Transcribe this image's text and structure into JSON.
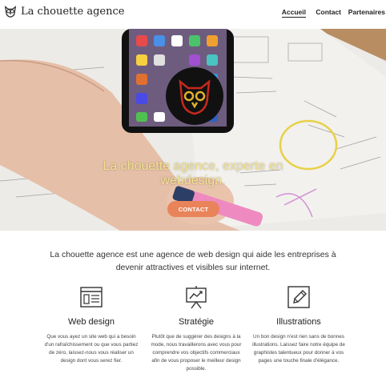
{
  "header": {
    "brand_name": "La chouette agence",
    "nav": [
      {
        "label": "Accueil",
        "active": true
      },
      {
        "label": "Contact",
        "active": false
      },
      {
        "label": "Partenaires",
        "active": false
      }
    ]
  },
  "hero": {
    "title_line1": "La chouette agence, experte en",
    "title_line2": "webdesign.",
    "cta_label": "CONTACT"
  },
  "intro": {
    "text": "La chouette agence est une agence de web design qui aide les entreprises à devenir attractives et visibles sur internet."
  },
  "features": [
    {
      "icon": "browser-window-icon",
      "title": "Web design",
      "description": "Que vous ayez un site web qui a besoin d'un rafraîchissement ou que vous partiez de zéro, laissez-nous vous réaliser un design dont vous serez fier."
    },
    {
      "icon": "chart-presentation-icon",
      "title": "Stratégie",
      "description": "Plutôt que de suggérer des designs à la mode, nous travaillerons avec vous pour comprendre vos objectifs commerciaux afin de vous proposer le meilleur design possible."
    },
    {
      "icon": "pen-drawing-icon",
      "title": "Illustrations",
      "description": "Un bon design n'est rien sans de bonnes illustrations. Laissez faire notre équipe de graphistes talentueux pour donner à vos pages une touche finale d'élégance."
    }
  ],
  "colors": {
    "accent": "#e9835a",
    "hero_text": "#f3e18e",
    "text": "#222222"
  }
}
